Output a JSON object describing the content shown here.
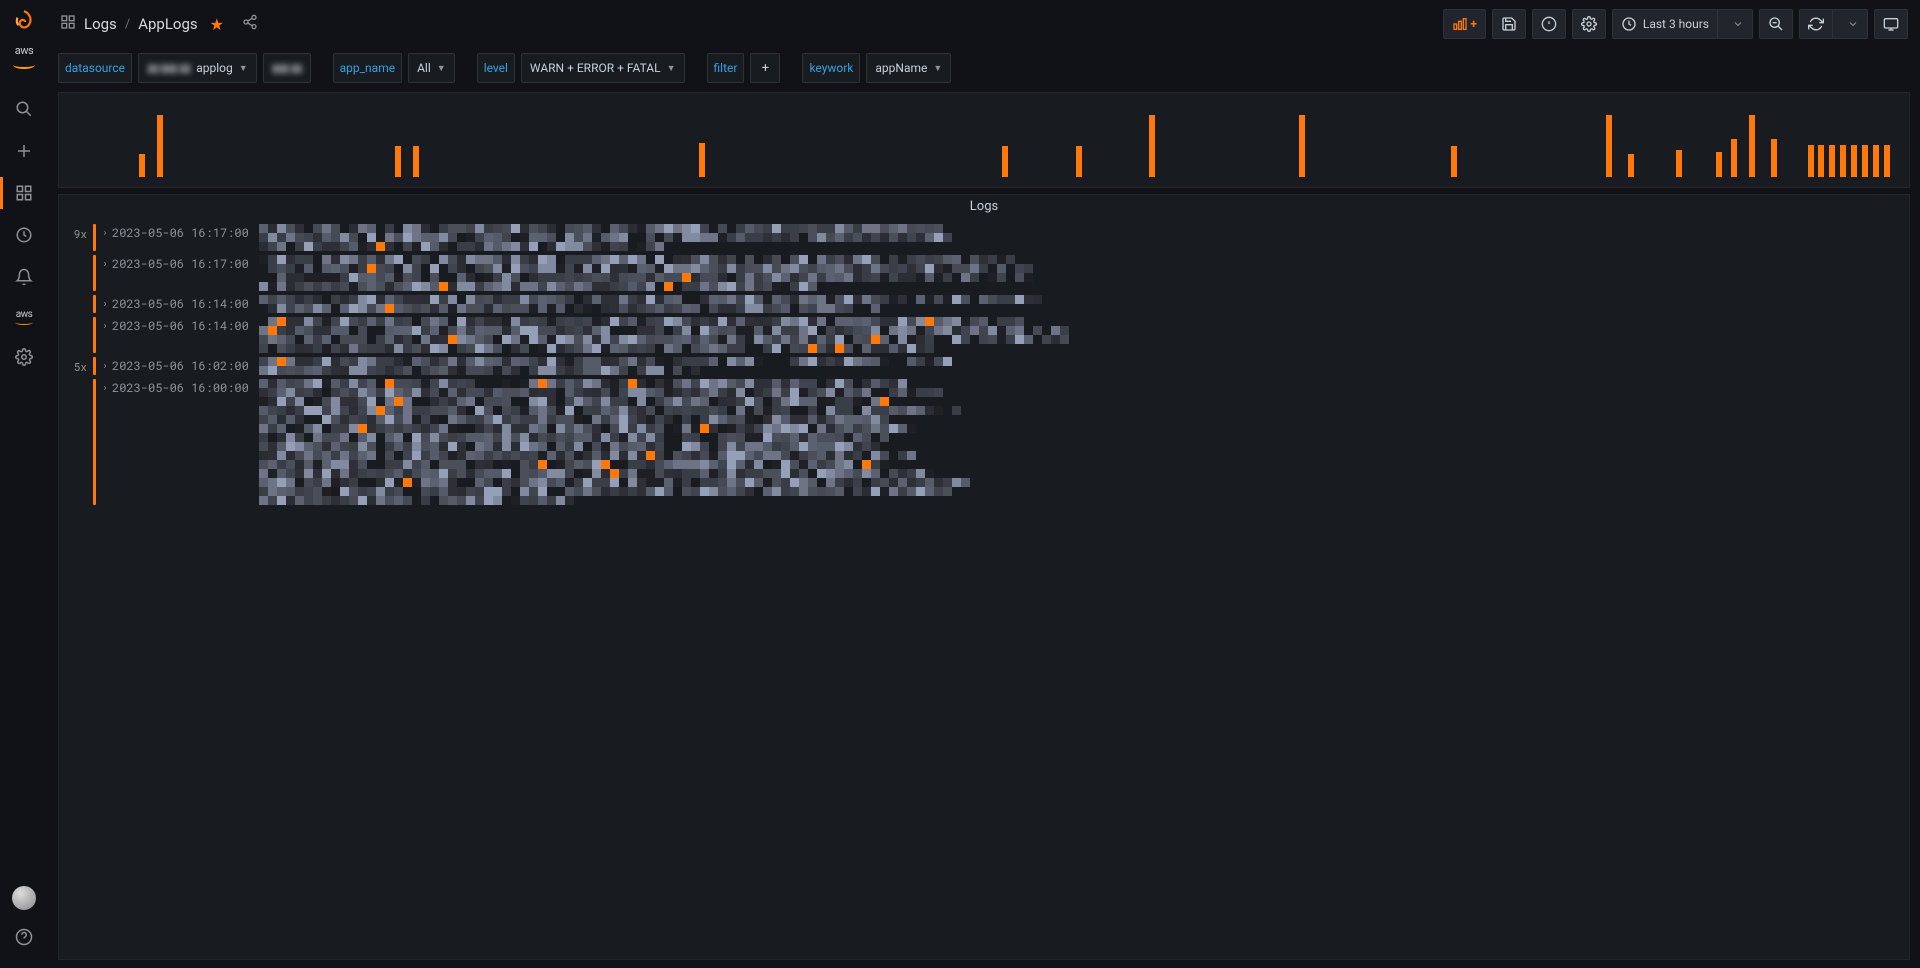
{
  "breadcrumb": {
    "root": "Logs",
    "page": "AppLogs"
  },
  "topbar": {
    "time_label": "Last 3 hours",
    "starred": true
  },
  "variables": {
    "datasource_label": "datasource",
    "datasource_value": "applog",
    "app_name_label": "app_name",
    "app_name_value": "All",
    "level_label": "level",
    "level_value": "WARN + ERROR + FATAL",
    "filter_label": "filter",
    "keyword_label": "keywork",
    "keyword_value": "appName"
  },
  "chart_data": {
    "type": "bar",
    "title": "",
    "xlabel": "",
    "ylabel": "",
    "ylim": [
      0,
      100
    ],
    "categories": [],
    "bars": [
      {
        "pos_pct": 3.8,
        "height_pct": 35
      },
      {
        "pos_pct": 4.8,
        "height_pct": 95
      },
      {
        "pos_pct": 17.8,
        "height_pct": 48
      },
      {
        "pos_pct": 18.8,
        "height_pct": 48
      },
      {
        "pos_pct": 34.4,
        "height_pct": 52
      },
      {
        "pos_pct": 51.0,
        "height_pct": 48
      },
      {
        "pos_pct": 55.0,
        "height_pct": 48
      },
      {
        "pos_pct": 59.0,
        "height_pct": 95
      },
      {
        "pos_pct": 67.2,
        "height_pct": 95
      },
      {
        "pos_pct": 75.5,
        "height_pct": 48
      },
      {
        "pos_pct": 84.0,
        "height_pct": 95
      },
      {
        "pos_pct": 85.2,
        "height_pct": 35
      },
      {
        "pos_pct": 87.8,
        "height_pct": 42
      },
      {
        "pos_pct": 90.0,
        "height_pct": 38
      },
      {
        "pos_pct": 90.8,
        "height_pct": 58
      },
      {
        "pos_pct": 91.8,
        "height_pct": 95
      },
      {
        "pos_pct": 93.0,
        "height_pct": 58
      },
      {
        "pos_pct": 95.0,
        "height_pct": 50
      },
      {
        "pos_pct": 95.6,
        "height_pct": 50
      },
      {
        "pos_pct": 96.2,
        "height_pct": 50
      },
      {
        "pos_pct": 96.8,
        "height_pct": 50
      },
      {
        "pos_pct": 97.4,
        "height_pct": 50
      },
      {
        "pos_pct": 98.0,
        "height_pct": 50
      },
      {
        "pos_pct": 98.6,
        "height_pct": 50
      },
      {
        "pos_pct": 99.2,
        "height_pct": 50
      }
    ]
  },
  "logs_panel": {
    "title": "Logs",
    "rows": [
      {
        "count": "9x",
        "timestamp": "2023-05-06 16:17:00",
        "redacted_lines": 3,
        "width_ratio": 0.6
      },
      {
        "count": "",
        "timestamp": "2023-05-06 16:17:00",
        "redacted_lines": 4,
        "width_ratio": 0.72
      },
      {
        "count": "",
        "timestamp": "2023-05-06 16:14:00",
        "redacted_lines": 2,
        "width_ratio": 0.68
      },
      {
        "count": "",
        "timestamp": "2023-05-06 16:14:00",
        "redacted_lines": 4,
        "width_ratio": 0.7
      },
      {
        "count": "5x",
        "timestamp": "2023-05-06 16:02:00",
        "redacted_lines": 2,
        "width_ratio": 0.66
      },
      {
        "count": "",
        "timestamp": "2023-05-06 16:00:00",
        "redacted_lines": 14,
        "width_ratio": 0.62
      }
    ]
  },
  "pixel_palette": [
    "#2a2d34",
    "#3a3e47",
    "#4a4f5a",
    "#5b6170",
    "#6e7486",
    "#828aa0",
    "#969fb8",
    "#2f2f38",
    "#454a55",
    "#393d46",
    "#555b68",
    "#40444e",
    "#1e2026"
  ],
  "pixel_accent": "#FF780A"
}
